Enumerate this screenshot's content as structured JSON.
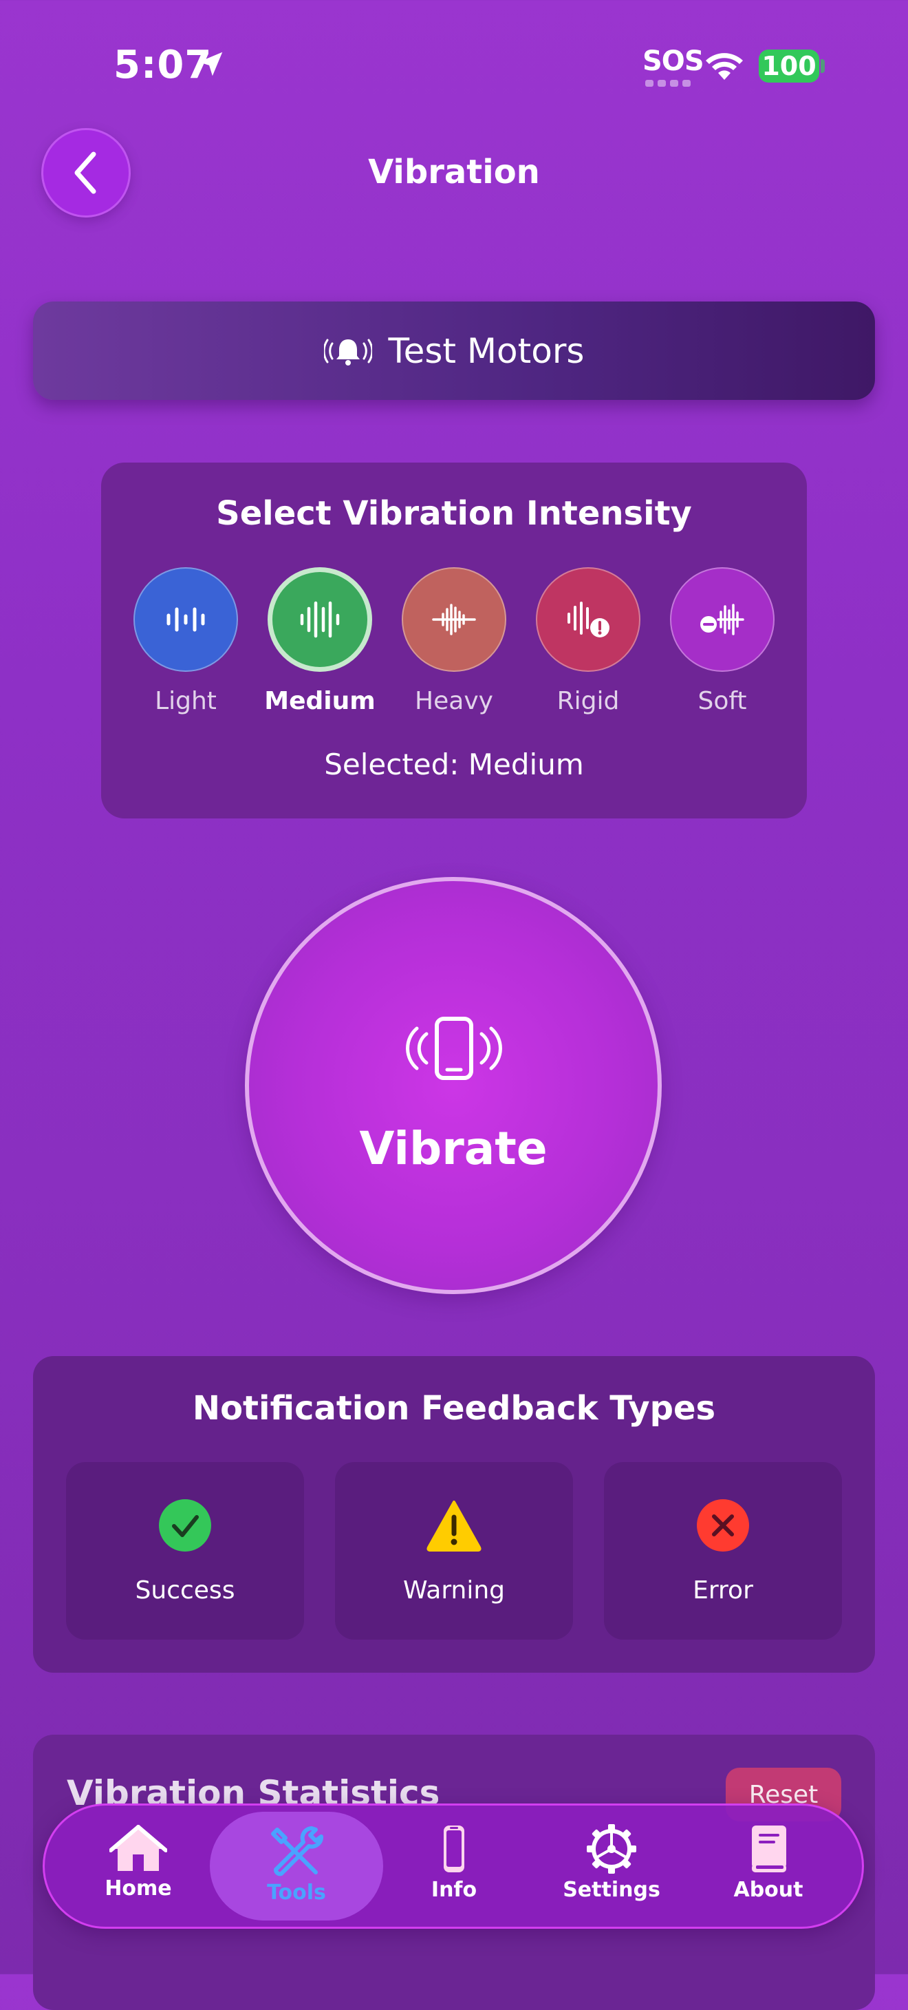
{
  "status_bar": {
    "time": "5:07",
    "sos": "SOS",
    "battery": "100"
  },
  "header": {
    "title": "Vibration"
  },
  "test_motors": {
    "label": "Test Motors"
  },
  "intensity": {
    "title": "Select Vibration Intensity",
    "options": [
      {
        "label": "Light",
        "color": "#3a63d6"
      },
      {
        "label": "Medium",
        "color": "#3aa85c"
      },
      {
        "label": "Heavy",
        "color": "#c0625e"
      },
      {
        "label": "Rigid",
        "color": "#bf3562"
      },
      {
        "label": "Soft",
        "color": "#a52ec8"
      }
    ],
    "selected_index": 1,
    "selected_text": "Selected: Medium"
  },
  "vibrate": {
    "label": "Vibrate"
  },
  "notification": {
    "title": "Notification Feedback Types",
    "items": [
      {
        "label": "Success",
        "icon": "checkmark-circle-icon",
        "color": "#34c759"
      },
      {
        "label": "Warning",
        "icon": "warning-triangle-icon",
        "color": "#ffcc00"
      },
      {
        "label": "Error",
        "icon": "x-circle-icon",
        "color": "#ff3b30"
      }
    ]
  },
  "statistics": {
    "title": "Vibration Statistics",
    "reset_label": "Reset"
  },
  "tab_bar": {
    "tabs": [
      {
        "label": "Home",
        "icon": "house-icon"
      },
      {
        "label": "Tools",
        "icon": "tools-icon"
      },
      {
        "label": "Info",
        "icon": "phone-icon"
      },
      {
        "label": "Settings",
        "icon": "gear-icon"
      },
      {
        "label": "About",
        "icon": "book-icon"
      }
    ],
    "active_index": 1
  }
}
